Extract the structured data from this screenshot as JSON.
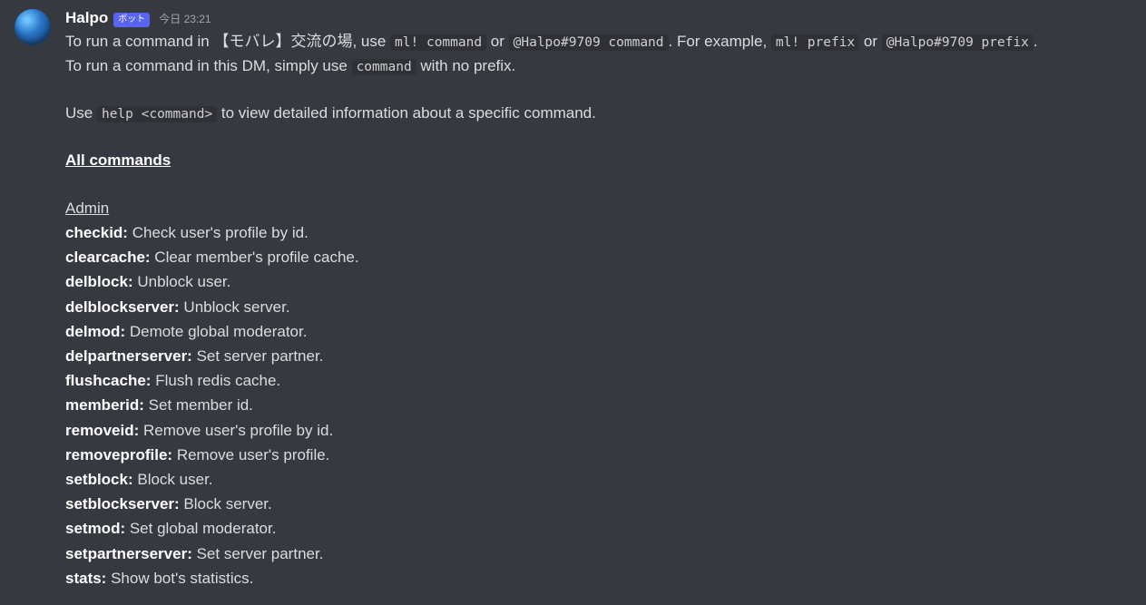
{
  "message": {
    "author": "Halpo",
    "bot_tag": "ボット",
    "timestamp": "今日 23:21",
    "intro": {
      "pre1": "To run a command in 【モバレ】交流の場, use ",
      "code1": "ml! command",
      "or1": " or ",
      "code2": "@Halpo#9709 command",
      "post1": ". For example, ",
      "code3": "ml! prefix",
      "or2": " or ",
      "code4": "@Halpo#9709 prefix",
      "post2": ".",
      "line2a": "To run a command in this DM, simply use ",
      "code5": "command",
      "line2b": " with no prefix.",
      "line3a": "Use ",
      "code6": "help <command>",
      "line3b": " to view detailed information about a specific command."
    },
    "all_commands_heading": "All commands",
    "section_admin": "Admin",
    "commands": [
      {
        "name": "checkid:",
        "desc": " Check user's profile by id."
      },
      {
        "name": "clearcache:",
        "desc": " Clear member's profile cache."
      },
      {
        "name": "delblock:",
        "desc": " Unblock user."
      },
      {
        "name": "delblockserver:",
        "desc": " Unblock server."
      },
      {
        "name": "delmod:",
        "desc": " Demote global moderator."
      },
      {
        "name": "delpartnerserver:",
        "desc": " Set server partner."
      },
      {
        "name": "flushcache:",
        "desc": " Flush redis cache."
      },
      {
        "name": "memberid:",
        "desc": " Set member id."
      },
      {
        "name": "removeid:",
        "desc": " Remove user's profile by id."
      },
      {
        "name": "removeprofile:",
        "desc": " Remove user's profile."
      },
      {
        "name": "setblock:",
        "desc": " Block user."
      },
      {
        "name": "setblockserver:",
        "desc": " Block server."
      },
      {
        "name": "setmod:",
        "desc": " Set global moderator."
      },
      {
        "name": "setpartnerserver:",
        "desc": " Set server partner."
      },
      {
        "name": "stats:",
        "desc": " Show bot's statistics."
      }
    ]
  }
}
